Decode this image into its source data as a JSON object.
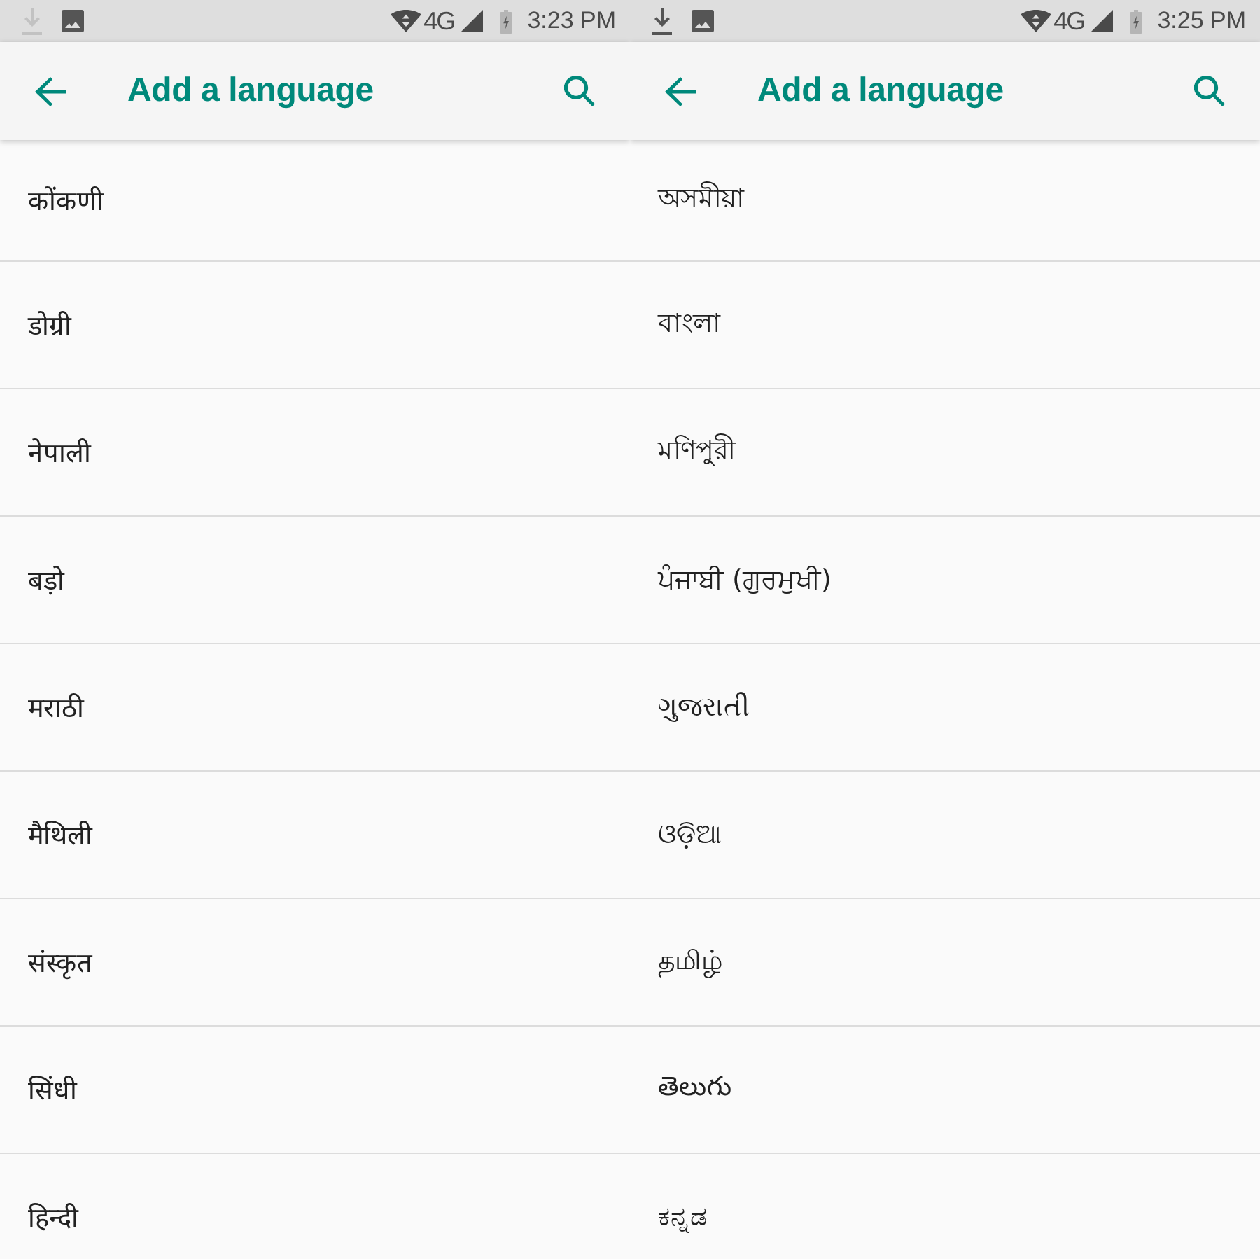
{
  "screens": [
    {
      "status_bar": {
        "notifications": [
          {
            "kind": "download",
            "dimmed": true
          },
          {
            "kind": "image",
            "dimmed": false
          }
        ],
        "network": "4G",
        "time": "3:23 PM"
      },
      "app_bar": {
        "title": "Add a language"
      },
      "languages": [
        "कोंकणी",
        "डोग्री",
        "नेपाली",
        "बड़ो",
        "मराठी",
        "मैथिली",
        "संस्कृत",
        "सिंधी",
        "हिन्दी"
      ]
    },
    {
      "status_bar": {
        "notifications": [
          {
            "kind": "download",
            "dimmed": false
          },
          {
            "kind": "image",
            "dimmed": false
          }
        ],
        "network": "4G",
        "time": "3:25 PM"
      },
      "app_bar": {
        "title": "Add a language"
      },
      "languages": [
        "অসমীয়া",
        "বাংলা",
        "মণিপুরী",
        "ਪੰਜਾਬੀ (ਗੁਰਮੁਖੀ)",
        "ગુજરાતી",
        "ଓଡ଼ିଆ",
        "தமிழ்",
        "తెలుగు",
        "ಕನ್ನಡ"
      ]
    }
  ]
}
